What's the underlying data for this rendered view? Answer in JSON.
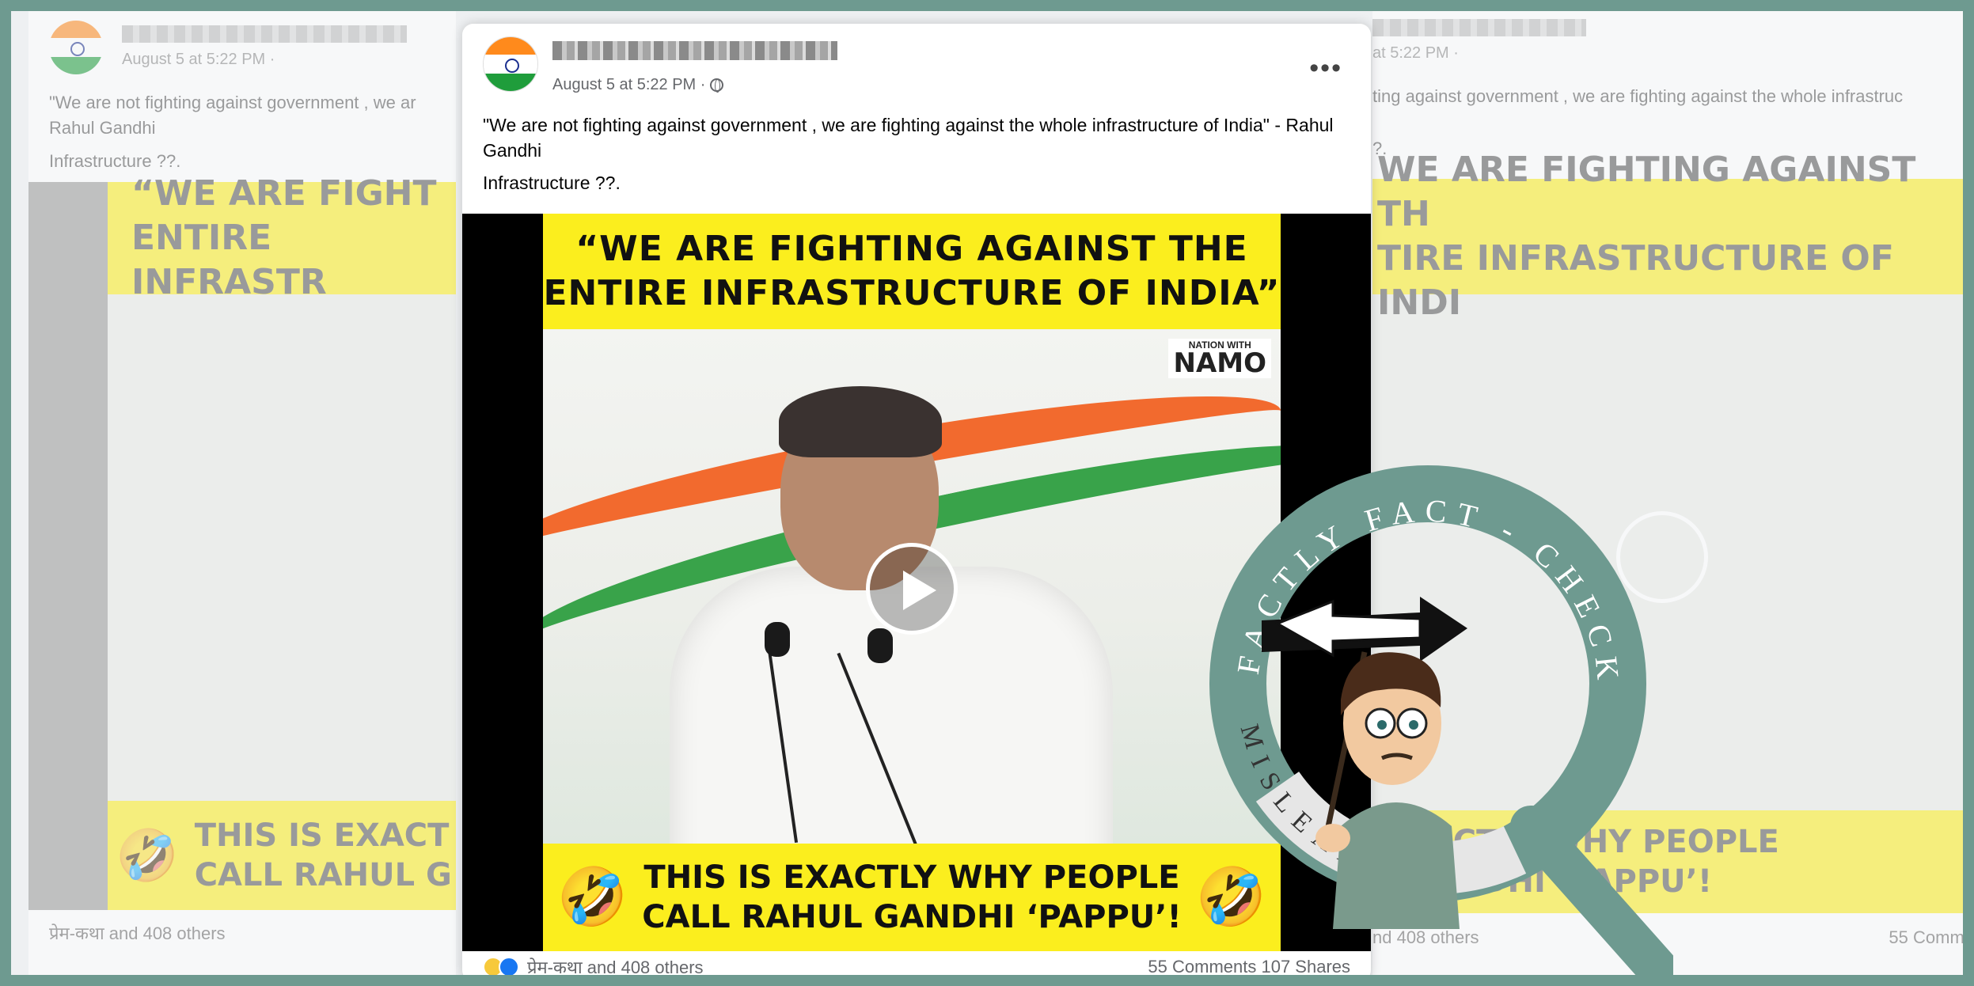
{
  "post": {
    "author": "",
    "date": "August 5 at 5:22 PM ·",
    "caption": "\"We are not fighting against government , we are fighting against the whole infrastructure of India\" - Rahul Gandhi",
    "caption2": "Infrastructure ??.",
    "more": "•••",
    "video": {
      "top_banner": "“WE ARE FIGHTING AGAINST THE\nENTIRE INFRASTRUCTURE OF INDIA”",
      "bottom_banner": "THIS IS EXACTLY WHY PEOPLE\nCALL RAHUL GANDHI ‘PAPPU’!",
      "watermark_line1": "NATION WITH",
      "watermark_line2": "NAMO",
      "emoji": "🤣"
    },
    "reactions_text": "प्रेम-कथा and 408 others",
    "comments_shares": "55 Comments  107 Shares"
  },
  "bg_left": {
    "date": "August 5 at 5:22 PM ·",
    "caption": "\"We are not fighting against government , we ar",
    "caption_line2": "Rahul Gandhi",
    "caption2": "Infrastructure ??.",
    "top_banner": "“WE ARE FIGHT\nENTIRE INFRASTR",
    "bottom_banner": "THIS IS EXACT\nCALL RAHUL G",
    "reactions_text": "प्रेम-कथा and 408 others"
  },
  "bg_right": {
    "date": "at 5:22 PM ·",
    "caption": "ting against government , we are fighting against the whole infrastruc",
    "caption2": "?.",
    "top_banner": "WE ARE FIGHTING AGAINST TH\nTIRE INFRASTRUCTURE OF INDI",
    "bottom_banner": "XACTLY WHY PEOPLE\nGANDHI ‘PAPPU’!",
    "reactions_text": "nd 408 others",
    "comments": "55 Comme"
  },
  "seal": {
    "ring_text": "FACTLY FACT - CHECK",
    "verdict": "MISLEADING"
  },
  "colors": {
    "frame": "#6e9a90",
    "banner": "#fbee1e",
    "seal": "#6e9a90"
  }
}
